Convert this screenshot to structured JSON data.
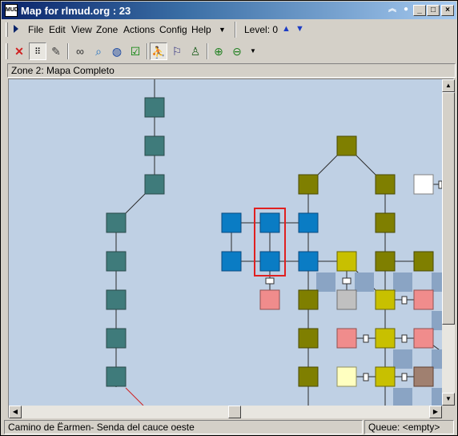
{
  "window": {
    "title": "Map for rlmud.org : 23",
    "app_icon": "MUD"
  },
  "menu": {
    "items": [
      "File",
      "Edit",
      "View",
      "Zone",
      "Actions",
      "Config",
      "Help"
    ],
    "level_label": "Level: 0"
  },
  "toolbar": {
    "icons": [
      "delete-icon",
      "grid-icon",
      "pencil-icon",
      "binoculars-icon",
      "find-icon",
      "globe-icon",
      "check-icon",
      "walk-icon",
      "person-path-icon",
      "person-icon",
      "zoom-in-icon",
      "zoom-out-icon"
    ]
  },
  "zone": {
    "header": "Zone 2: Mapa Completo"
  },
  "map": {
    "background": "#bfd0e4",
    "colors": {
      "teal": "#3f7b7b",
      "blue": "#0a7cc4",
      "olive": "#7f7f00",
      "yellow": "#c8c000",
      "pink": "#f08c8c",
      "gray": "#c0c0c0",
      "white": "#ffffff",
      "cream": "#ffffc0",
      "brown": "#a08070",
      "selection": "#e02020"
    }
  },
  "status": {
    "location": "Camino de Ëarmen- Senda del cauce oeste",
    "queue": "Queue: <empty>"
  }
}
